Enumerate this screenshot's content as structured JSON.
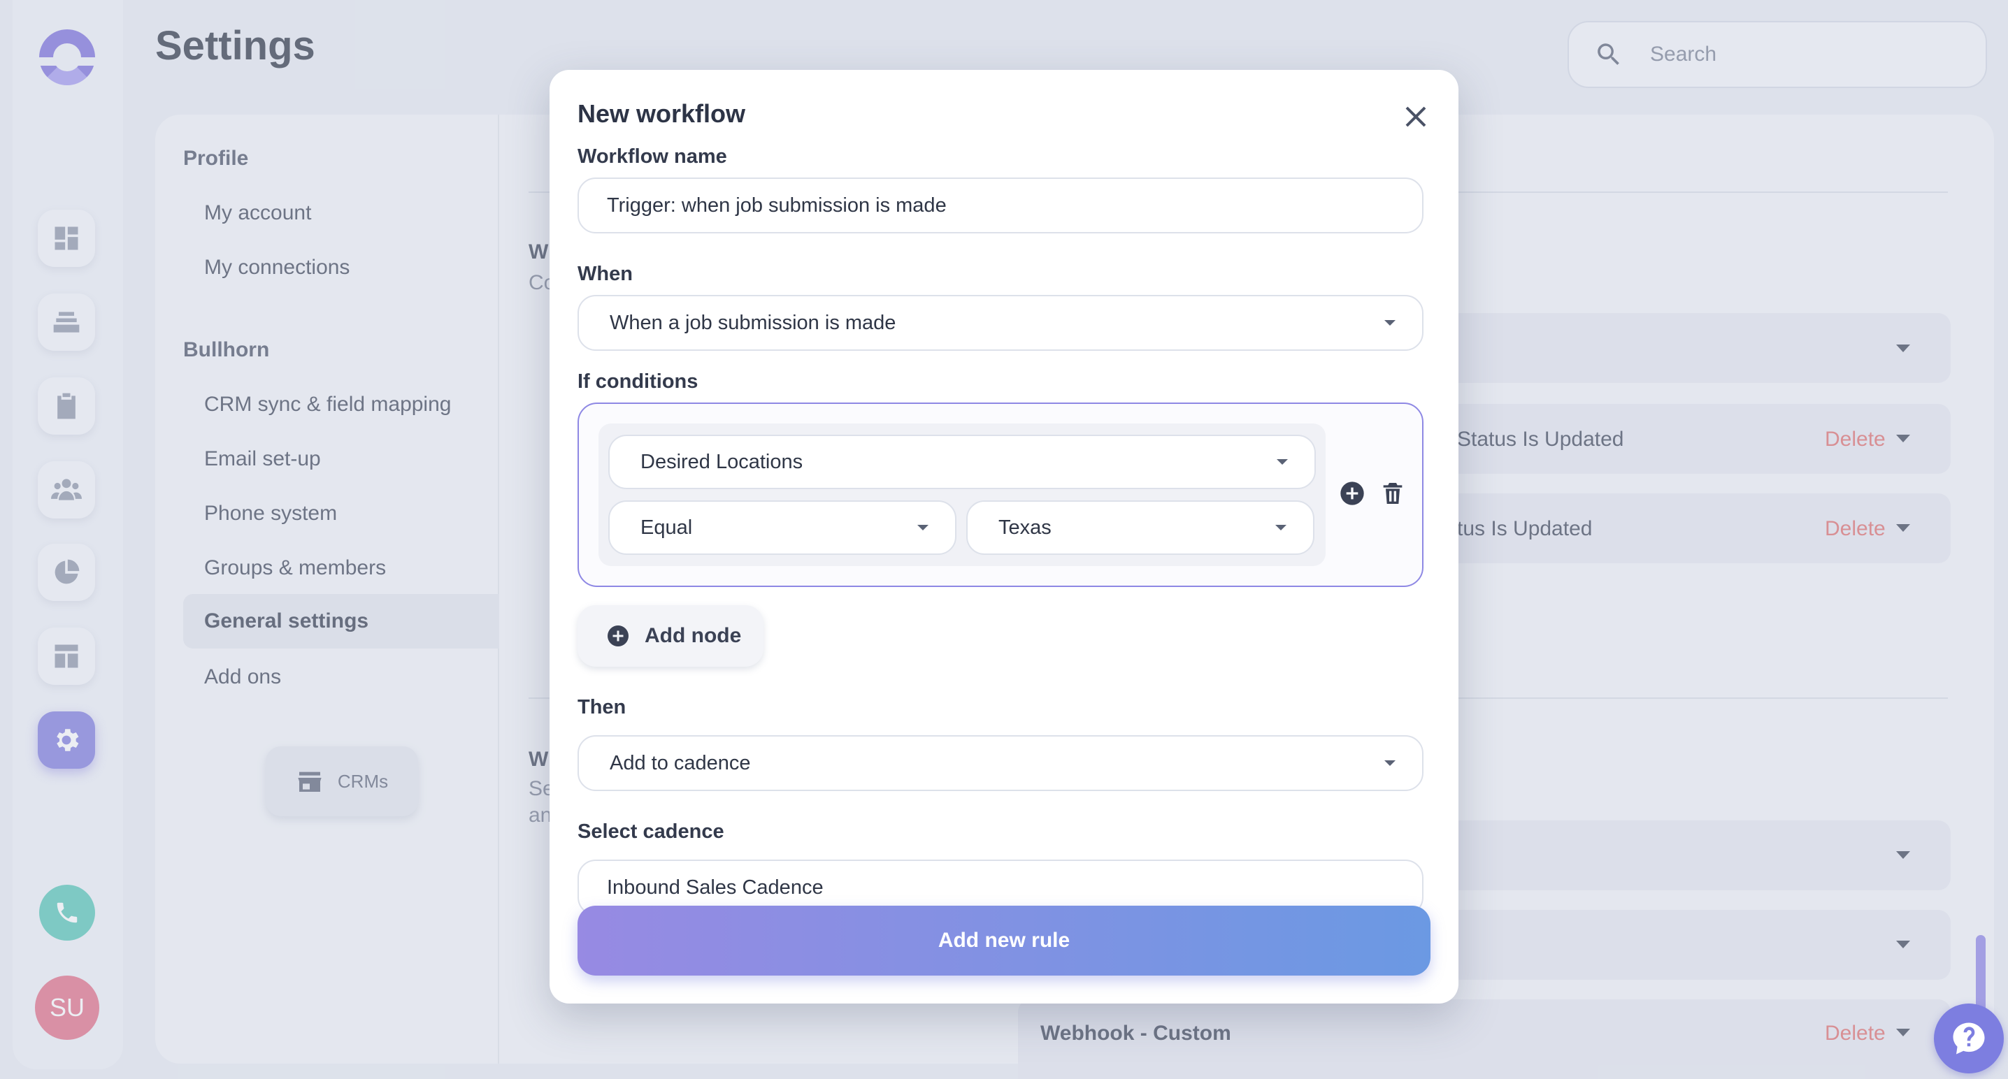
{
  "app": {
    "page_title": "Settings",
    "search_placeholder": "Search",
    "user_initials": "SU"
  },
  "nav": {
    "profile_heading": "Profile",
    "profile_items": [
      "My account",
      "My connections"
    ],
    "bullhorn_heading": "Bullhorn",
    "bullhorn_items": [
      "CRM sync & field mapping",
      "Email set-up",
      "Phone system",
      "Groups & members",
      "General settings",
      "Add ons"
    ],
    "active_item": "General settings",
    "crm_button": "CRMs"
  },
  "background": {
    "fragments": [
      "W",
      "Co",
      "W",
      "Se",
      "an"
    ],
    "rows": [
      {
        "text": "",
        "delete": ""
      },
      {
        "text": "Status Is Updated",
        "delete": "Delete"
      },
      {
        "text": "tus Is Updated",
        "delete": "Delete"
      },
      {
        "text": "",
        "delete": ""
      },
      {
        "text": "",
        "delete": ""
      },
      {
        "text": "Webhook - Custom",
        "delete": "Delete"
      }
    ]
  },
  "modal": {
    "title": "New workflow",
    "workflow_name_label": "Workflow name",
    "workflow_name_value": "Trigger: when job submission is made",
    "when_label": "When",
    "when_value": "When a job submission is made",
    "if_label": "If conditions",
    "condition": {
      "field": "Desired Locations",
      "operator": "Equal",
      "value": "Texas"
    },
    "add_node_label": "Add node",
    "then_label": "Then",
    "then_value": "Add to cadence",
    "select_cadence_label": "Select cadence",
    "cadence_value": "Inbound Sales Cadence",
    "submit_label": "Add new rule"
  },
  "colors": {
    "accent": "#7e7cde",
    "delete": "#e06d6d",
    "phone": "#56c7b7",
    "avatar": "#e26f87",
    "condition_border": "#8e88e4"
  }
}
